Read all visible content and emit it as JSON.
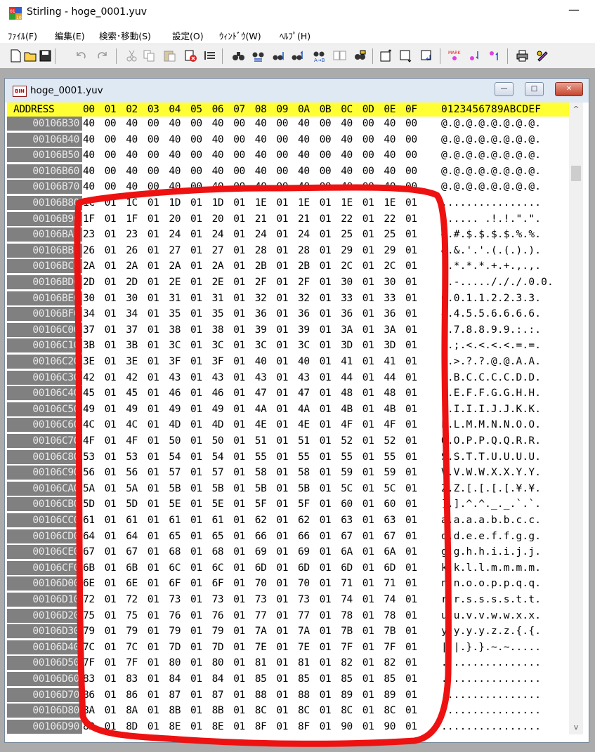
{
  "window": {
    "title": "Stirling - hoge_0001.yuv",
    "minimize_glyph": "—"
  },
  "menu": [
    {
      "label": "ﾌｧｲﾙ(F)"
    },
    {
      "label": "編集(E)"
    },
    {
      "label": "検索･移動(S)"
    },
    {
      "label": "設定(O)"
    },
    {
      "label": "ｳｨﾝﾄﾞｳ(W)"
    },
    {
      "label": "ﾍﾙﾌﾟ(H)"
    }
  ],
  "toolbar": {
    "buttons": [
      "new-file-icon",
      "open-file-icon",
      "save-icon",
      "undo-icon",
      "redo-icon",
      "cut-icon",
      "copy-icon",
      "paste-icon",
      "delete-icon",
      "insert-mode-icon",
      "find-icon",
      "find-next-icon",
      "find-down-icon",
      "find-up-icon",
      "replace-icon",
      "compare-icon",
      "bookmark-list-icon",
      "go-top-icon",
      "go-bottom-icon",
      "go-address-icon",
      "mark-icon",
      "next-mark-icon",
      "prev-mark-icon",
      "print-icon",
      "settings-icon"
    ]
  },
  "document": {
    "title": "hoge_0001.yuv",
    "icon_label": "BIN",
    "window_buttons": {
      "minimize": "—",
      "maximize": "□",
      "close": "✕"
    }
  },
  "hex": {
    "header": {
      "address_label": "ADDRESS",
      "columns": [
        "00",
        "01",
        "02",
        "03",
        "04",
        "05",
        "06",
        "07",
        "08",
        "09",
        "0A",
        "0B",
        "0C",
        "0D",
        "0E",
        "0F"
      ],
      "ascii_label": "0123456789ABCDEF"
    },
    "rows": [
      {
        "address": "00106B30",
        "bytes": [
          "40",
          "00",
          "40",
          "00",
          "40",
          "00",
          "40",
          "00",
          "40",
          "00",
          "40",
          "00",
          "40",
          "00",
          "40",
          "00"
        ],
        "ascii": "@.@.@.@.@.@.@.@."
      },
      {
        "address": "00106B40",
        "bytes": [
          "40",
          "00",
          "40",
          "00",
          "40",
          "00",
          "40",
          "00",
          "40",
          "00",
          "40",
          "00",
          "40",
          "00",
          "40",
          "00"
        ],
        "ascii": "@.@.@.@.@.@.@.@."
      },
      {
        "address": "00106B50",
        "bytes": [
          "40",
          "00",
          "40",
          "00",
          "40",
          "00",
          "40",
          "00",
          "40",
          "00",
          "40",
          "00",
          "40",
          "00",
          "40",
          "00"
        ],
        "ascii": "@.@.@.@.@.@.@.@."
      },
      {
        "address": "00106B60",
        "bytes": [
          "40",
          "00",
          "40",
          "00",
          "40",
          "00",
          "40",
          "00",
          "40",
          "00",
          "40",
          "00",
          "40",
          "00",
          "40",
          "00"
        ],
        "ascii": "@.@.@.@.@.@.@.@."
      },
      {
        "address": "00106B70",
        "bytes": [
          "40",
          "00",
          "40",
          "00",
          "40",
          "00",
          "40",
          "00",
          "40",
          "00",
          "40",
          "00",
          "40",
          "00",
          "40",
          "00"
        ],
        "ascii": "@.@.@.@.@.@.@.@."
      },
      {
        "address": "00106B80",
        "bytes": [
          "1C",
          "01",
          "1C",
          "01",
          "1D",
          "01",
          "1D",
          "01",
          "1E",
          "01",
          "1E",
          "01",
          "1E",
          "01",
          "1E",
          "01"
        ],
        "ascii": "................"
      },
      {
        "address": "00106B90",
        "bytes": [
          "1F",
          "01",
          "1F",
          "01",
          "20",
          "01",
          "20",
          "01",
          "21",
          "01",
          "21",
          "01",
          "22",
          "01",
          "22",
          "01"
        ],
        "ascii": "...... .!.!.\".\"."
      },
      {
        "address": "00106BA0",
        "bytes": [
          "23",
          "01",
          "23",
          "01",
          "24",
          "01",
          "24",
          "01",
          "24",
          "01",
          "24",
          "01",
          "25",
          "01",
          "25",
          "01"
        ],
        "ascii": "#.#.$.$.$.$.%.%."
      },
      {
        "address": "00106BB0",
        "bytes": [
          "26",
          "01",
          "26",
          "01",
          "27",
          "01",
          "27",
          "01",
          "28",
          "01",
          "28",
          "01",
          "29",
          "01",
          "29",
          "01"
        ],
        "ascii": "&.&.'.'.(.(.).)."
      },
      {
        "address": "00106BC0",
        "bytes": [
          "2A",
          "01",
          "2A",
          "01",
          "2A",
          "01",
          "2A",
          "01",
          "2B",
          "01",
          "2B",
          "01",
          "2C",
          "01",
          "2C",
          "01"
        ],
        "ascii": "*.*.*.*.+.+.,.,."
      },
      {
        "address": "00106BD0",
        "bytes": [
          "2D",
          "01",
          "2D",
          "01",
          "2E",
          "01",
          "2E",
          "01",
          "2F",
          "01",
          "2F",
          "01",
          "30",
          "01",
          "30",
          "01"
        ],
        "ascii": "-.-...../././.0.0."
      },
      {
        "address": "00106BE0",
        "bytes": [
          "30",
          "01",
          "30",
          "01",
          "31",
          "01",
          "31",
          "01",
          "32",
          "01",
          "32",
          "01",
          "33",
          "01",
          "33",
          "01"
        ],
        "ascii": "0.0.1.1.2.2.3.3."
      },
      {
        "address": "00106BF0",
        "bytes": [
          "34",
          "01",
          "34",
          "01",
          "35",
          "01",
          "35",
          "01",
          "36",
          "01",
          "36",
          "01",
          "36",
          "01",
          "36",
          "01"
        ],
        "ascii": "4.4.5.5.6.6.6.6."
      },
      {
        "address": "00106C00",
        "bytes": [
          "37",
          "01",
          "37",
          "01",
          "38",
          "01",
          "38",
          "01",
          "39",
          "01",
          "39",
          "01",
          "3A",
          "01",
          "3A",
          "01"
        ],
        "ascii": "7.7.8.8.9.9.:.:."
      },
      {
        "address": "00106C10",
        "bytes": [
          "3B",
          "01",
          "3B",
          "01",
          "3C",
          "01",
          "3C",
          "01",
          "3C",
          "01",
          "3C",
          "01",
          "3D",
          "01",
          "3D",
          "01"
        ],
        "ascii": ";.;.<.<.<.<.=.=."
      },
      {
        "address": "00106C20",
        "bytes": [
          "3E",
          "01",
          "3E",
          "01",
          "3F",
          "01",
          "3F",
          "01",
          "40",
          "01",
          "40",
          "01",
          "41",
          "01",
          "41",
          "01"
        ],
        "ascii": ">.>.?.?.@.@.A.A."
      },
      {
        "address": "00106C30",
        "bytes": [
          "42",
          "01",
          "42",
          "01",
          "43",
          "01",
          "43",
          "01",
          "43",
          "01",
          "43",
          "01",
          "44",
          "01",
          "44",
          "01"
        ],
        "ascii": "B.B.C.C.C.C.D.D."
      },
      {
        "address": "00106C40",
        "bytes": [
          "45",
          "01",
          "45",
          "01",
          "46",
          "01",
          "46",
          "01",
          "47",
          "01",
          "47",
          "01",
          "48",
          "01",
          "48",
          "01"
        ],
        "ascii": "E.E.F.F.G.G.H.H."
      },
      {
        "address": "00106C50",
        "bytes": [
          "49",
          "01",
          "49",
          "01",
          "49",
          "01",
          "49",
          "01",
          "4A",
          "01",
          "4A",
          "01",
          "4B",
          "01",
          "4B",
          "01"
        ],
        "ascii": "I.I.I.I.J.J.K.K."
      },
      {
        "address": "00106C60",
        "bytes": [
          "4C",
          "01",
          "4C",
          "01",
          "4D",
          "01",
          "4D",
          "01",
          "4E",
          "01",
          "4E",
          "01",
          "4F",
          "01",
          "4F",
          "01"
        ],
        "ascii": "L.L.M.M.N.N.O.O."
      },
      {
        "address": "00106C70",
        "bytes": [
          "4F",
          "01",
          "4F",
          "01",
          "50",
          "01",
          "50",
          "01",
          "51",
          "01",
          "51",
          "01",
          "52",
          "01",
          "52",
          "01"
        ],
        "ascii": "O.O.P.P.Q.Q.R.R."
      },
      {
        "address": "00106C80",
        "bytes": [
          "53",
          "01",
          "53",
          "01",
          "54",
          "01",
          "54",
          "01",
          "55",
          "01",
          "55",
          "01",
          "55",
          "01",
          "55",
          "01"
        ],
        "ascii": "S.S.T.T.U.U.U.U."
      },
      {
        "address": "00106C90",
        "bytes": [
          "56",
          "01",
          "56",
          "01",
          "57",
          "01",
          "57",
          "01",
          "58",
          "01",
          "58",
          "01",
          "59",
          "01",
          "59",
          "01"
        ],
        "ascii": "V.V.W.W.X.X.Y.Y."
      },
      {
        "address": "00106CA0",
        "bytes": [
          "5A",
          "01",
          "5A",
          "01",
          "5B",
          "01",
          "5B",
          "01",
          "5B",
          "01",
          "5B",
          "01",
          "5C",
          "01",
          "5C",
          "01"
        ],
        "ascii": "Z.Z.[.[.[.[.¥.¥."
      },
      {
        "address": "00106CB0",
        "bytes": [
          "5D",
          "01",
          "5D",
          "01",
          "5E",
          "01",
          "5E",
          "01",
          "5F",
          "01",
          "5F",
          "01",
          "60",
          "01",
          "60",
          "01"
        ],
        "ascii": "].].^.^._._.`.`."
      },
      {
        "address": "00106CC0",
        "bytes": [
          "61",
          "01",
          "61",
          "01",
          "61",
          "01",
          "61",
          "01",
          "62",
          "01",
          "62",
          "01",
          "63",
          "01",
          "63",
          "01"
        ],
        "ascii": "a.a.a.a.b.b.c.c."
      },
      {
        "address": "00106CD0",
        "bytes": [
          "64",
          "01",
          "64",
          "01",
          "65",
          "01",
          "65",
          "01",
          "66",
          "01",
          "66",
          "01",
          "67",
          "01",
          "67",
          "01"
        ],
        "ascii": "d.d.e.e.f.f.g.g."
      },
      {
        "address": "00106CE0",
        "bytes": [
          "67",
          "01",
          "67",
          "01",
          "68",
          "01",
          "68",
          "01",
          "69",
          "01",
          "69",
          "01",
          "6A",
          "01",
          "6A",
          "01"
        ],
        "ascii": "g.g.h.h.i.i.j.j."
      },
      {
        "address": "00106CF0",
        "bytes": [
          "6B",
          "01",
          "6B",
          "01",
          "6C",
          "01",
          "6C",
          "01",
          "6D",
          "01",
          "6D",
          "01",
          "6D",
          "01",
          "6D",
          "01"
        ],
        "ascii": "k.k.l.l.m.m.m.m."
      },
      {
        "address": "00106D00",
        "bytes": [
          "6E",
          "01",
          "6E",
          "01",
          "6F",
          "01",
          "6F",
          "01",
          "70",
          "01",
          "70",
          "01",
          "71",
          "01",
          "71",
          "01"
        ],
        "ascii": "n.n.o.o.p.p.q.q."
      },
      {
        "address": "00106D10",
        "bytes": [
          "72",
          "01",
          "72",
          "01",
          "73",
          "01",
          "73",
          "01",
          "73",
          "01",
          "73",
          "01",
          "74",
          "01",
          "74",
          "01"
        ],
        "ascii": "r.r.s.s.s.s.t.t."
      },
      {
        "address": "00106D20",
        "bytes": [
          "75",
          "01",
          "75",
          "01",
          "76",
          "01",
          "76",
          "01",
          "77",
          "01",
          "77",
          "01",
          "78",
          "01",
          "78",
          "01"
        ],
        "ascii": "u.u.v.v.w.w.x.x."
      },
      {
        "address": "00106D30",
        "bytes": [
          "79",
          "01",
          "79",
          "01",
          "79",
          "01",
          "79",
          "01",
          "7A",
          "01",
          "7A",
          "01",
          "7B",
          "01",
          "7B",
          "01"
        ],
        "ascii": "y.y.y.y.z.z.{.{."
      },
      {
        "address": "00106D40",
        "bytes": [
          "7C",
          "01",
          "7C",
          "01",
          "7D",
          "01",
          "7D",
          "01",
          "7E",
          "01",
          "7E",
          "01",
          "7F",
          "01",
          "7F",
          "01"
        ],
        "ascii": "|.|.}.}.~.~....."
      },
      {
        "address": "00106D50",
        "bytes": [
          "7F",
          "01",
          "7F",
          "01",
          "80",
          "01",
          "80",
          "01",
          "81",
          "01",
          "81",
          "01",
          "82",
          "01",
          "82",
          "01"
        ],
        "ascii": "................"
      },
      {
        "address": "00106D60",
        "bytes": [
          "83",
          "01",
          "83",
          "01",
          "84",
          "01",
          "84",
          "01",
          "85",
          "01",
          "85",
          "01",
          "85",
          "01",
          "85",
          "01"
        ],
        "ascii": "................"
      },
      {
        "address": "00106D70",
        "bytes": [
          "86",
          "01",
          "86",
          "01",
          "87",
          "01",
          "87",
          "01",
          "88",
          "01",
          "88",
          "01",
          "89",
          "01",
          "89",
          "01"
        ],
        "ascii": "................"
      },
      {
        "address": "00106D80",
        "bytes": [
          "8A",
          "01",
          "8A",
          "01",
          "8B",
          "01",
          "8B",
          "01",
          "8C",
          "01",
          "8C",
          "01",
          "8C",
          "01",
          "8C",
          "01"
        ],
        "ascii": "................"
      },
      {
        "address": "00106D90",
        "bytes": [
          "8D",
          "01",
          "8D",
          "01",
          "8E",
          "01",
          "8E",
          "01",
          "8F",
          "01",
          "8F",
          "01",
          "90",
          "01",
          "90",
          "01"
        ],
        "ascii": "................"
      }
    ]
  },
  "colors": {
    "header_bg": "#ffff33",
    "address_bg": "#808080",
    "annotation": "#ee1111"
  },
  "scrollbar": {
    "up_glyph": "^",
    "down_glyph": "v"
  }
}
